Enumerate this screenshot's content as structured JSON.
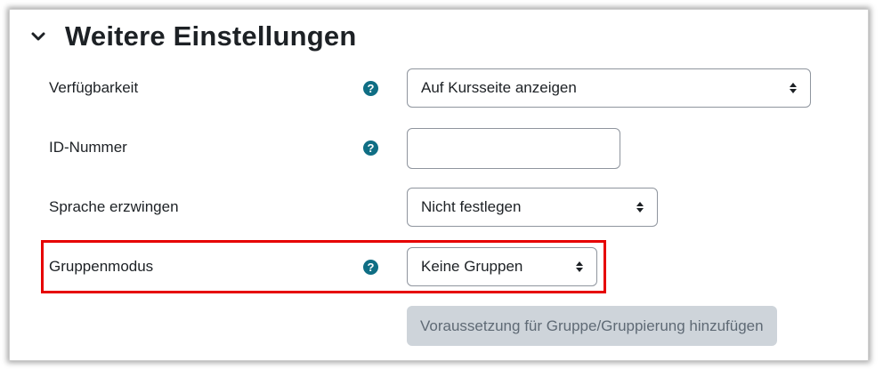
{
  "section": {
    "title": "Weitere Einstellungen"
  },
  "fields": {
    "visibility": {
      "label": "Verfügbarkeit",
      "value": "Auf Kursseite anzeigen"
    },
    "idnumber": {
      "label": "ID-Nummer",
      "value": ""
    },
    "language": {
      "label": "Sprache erzwingen",
      "value": "Nicht festlegen"
    },
    "groupmode": {
      "label": "Gruppenmodus",
      "value": "Keine Gruppen"
    }
  },
  "help_icon_text": "?",
  "restriction_button": {
    "label": "Voraussetzung für Gruppe/Gruppierung hinzufügen"
  },
  "colors": {
    "help_icon": "#0f6e84",
    "highlight": "#e60000",
    "disabled_button_bg": "#ced4da"
  },
  "icons": {
    "collapse": "chevron-down-icon",
    "help": "question-circle-icon",
    "select": "sort-up-down-icon"
  }
}
